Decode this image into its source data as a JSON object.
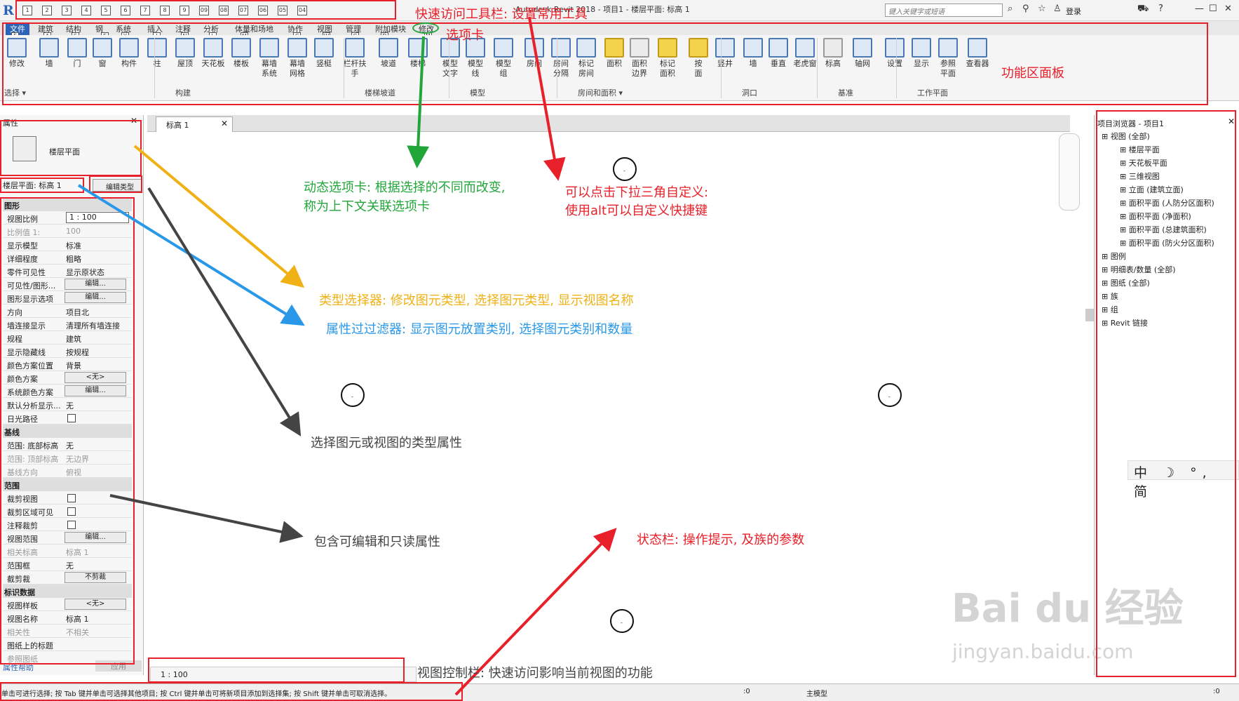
{
  "titlebar": {
    "logo": "R",
    "qa_icons": [
      "1",
      "2",
      "3",
      "4",
      "5",
      "6",
      "7",
      "8",
      "9",
      "09",
      "08",
      "07",
      "06",
      "05",
      "04"
    ],
    "title": "Autodesk Revit 2018 - 项目1 - 楼层平面: 标高 1",
    "search_placeholder": "键入关键字或短语",
    "login_label": "登录",
    "icons": [
      "binoculars-icon",
      "share-icon",
      "star-icon",
      "user-icon",
      "cart-icon",
      "help-icon"
    ],
    "window_controls": [
      "—",
      "☐",
      "✕"
    ]
  },
  "tabs": [
    {
      "label": "文件",
      "key": "F",
      "active": true
    },
    {
      "label": "建筑",
      "key": "A"
    },
    {
      "label": "结构",
      "key": "S"
    },
    {
      "label": "钢",
      "key": "E"
    },
    {
      "label": "系统",
      "key": "Y"
    },
    {
      "label": "插入",
      "key": "I"
    },
    {
      "label": "注释",
      "key": "N"
    },
    {
      "label": "分析",
      "key": "L"
    },
    {
      "label": "体量和场地",
      "key": "M"
    },
    {
      "label": "协作",
      "key": "C"
    },
    {
      "label": "视图",
      "key": "W"
    },
    {
      "label": "管理",
      "key": "G"
    },
    {
      "label": "附加模块",
      "key": "D"
    },
    {
      "label": "修改",
      "key": "M"
    }
  ],
  "ribbon": {
    "buttons": [
      {
        "label": "修改"
      },
      {
        "label": "墙"
      },
      {
        "label": "门"
      },
      {
        "label": "窗"
      },
      {
        "label": "构件"
      },
      {
        "label": "柱"
      },
      {
        "label": "屋顶"
      },
      {
        "label": "天花板"
      },
      {
        "label": "楼板"
      },
      {
        "label": "幕墙\n系统"
      },
      {
        "label": "幕墙\n网格"
      },
      {
        "label": "竖梃"
      },
      {
        "label": "栏杆扶手"
      },
      {
        "label": "坡道"
      },
      {
        "label": "楼梯"
      },
      {
        "label": "模型\n文字"
      },
      {
        "label": "模型\n线"
      },
      {
        "label": "模型\n组"
      },
      {
        "label": "房间"
      },
      {
        "label": "房间\n分隔"
      },
      {
        "label": "标记\n房间"
      },
      {
        "label": "面积"
      },
      {
        "label": "面积\n边界"
      },
      {
        "label": "标记\n面积"
      },
      {
        "label": "按\n面"
      },
      {
        "label": "竖井"
      },
      {
        "label": "墙"
      },
      {
        "label": "垂直"
      },
      {
        "label": "老虎窗"
      },
      {
        "label": "标高"
      },
      {
        "label": "轴网"
      },
      {
        "label": "设置"
      },
      {
        "label": "显示"
      },
      {
        "label": "参照\n平面"
      },
      {
        "label": "查看器"
      }
    ],
    "panels": [
      "选择 ▾",
      "构建",
      "楼梯坡道",
      "模型",
      "房间和面积 ▾",
      "洞口",
      "基准",
      "工作平面"
    ]
  },
  "doc_tab": {
    "label": "标高 1"
  },
  "properties": {
    "header": "属性",
    "type_name": "楼层平面",
    "filter": "楼层平面: 标高 1",
    "edit_type": "编辑类型",
    "groups": [
      {
        "name": "图形",
        "rows": [
          [
            "视图比例",
            "1 : 100",
            "input"
          ],
          [
            "比例值 1:",
            "100",
            "dim"
          ],
          [
            "显示模型",
            "标准",
            ""
          ],
          [
            "详细程度",
            "粗略",
            ""
          ],
          [
            "零件可见性",
            "显示原状态",
            ""
          ],
          [
            "可见性/图形...",
            "编辑...",
            "btn"
          ],
          [
            "图形显示选项",
            "编辑...",
            "btn"
          ],
          [
            "方向",
            "项目北",
            ""
          ],
          [
            "墙连接显示",
            "清理所有墙连接",
            ""
          ],
          [
            "规程",
            "建筑",
            ""
          ],
          [
            "显示隐藏线",
            "按规程",
            ""
          ],
          [
            "颜色方案位置",
            "背景",
            ""
          ],
          [
            "颜色方案",
            "<无>",
            "btn"
          ],
          [
            "系统颜色方案",
            "编辑...",
            "btn"
          ],
          [
            "默认分析显示...",
            "无",
            ""
          ],
          [
            "日光路径",
            "",
            "chk"
          ]
        ]
      },
      {
        "name": "基线",
        "rows": [
          [
            "范围: 底部标高",
            "无",
            ""
          ],
          [
            "范围: 顶部标高",
            "无边界",
            "dim"
          ],
          [
            "基线方向",
            "俯视",
            "dim"
          ]
        ]
      },
      {
        "name": "范围",
        "rows": [
          [
            "裁剪视图",
            "",
            "chk"
          ],
          [
            "裁剪区域可见",
            "",
            "chk"
          ],
          [
            "注释裁剪",
            "",
            "chk"
          ],
          [
            "视图范围",
            "编辑...",
            "btn"
          ],
          [
            "相关标高",
            "标高 1",
            "dim"
          ],
          [
            "范围框",
            "无",
            ""
          ],
          [
            "截剪裁",
            "不剪裁",
            "btn"
          ]
        ]
      },
      {
        "name": "标识数据",
        "rows": [
          [
            "视图样板",
            "<无>",
            "btn"
          ],
          [
            "视图名称",
            "标高 1",
            ""
          ],
          [
            "相关性",
            "不相关",
            "dim"
          ],
          [
            "图纸上的标题",
            "",
            ""
          ],
          [
            "参照图纸",
            "",
            "dim"
          ]
        ]
      }
    ],
    "help": "属性帮助",
    "apply": "应用"
  },
  "browser": {
    "header": "项目浏览器 - 项目1",
    "items": [
      {
        "label": "视图 (全部)",
        "level": 0
      },
      {
        "label": "楼层平面",
        "level": 1
      },
      {
        "label": "天花板平面",
        "level": 1
      },
      {
        "label": "三维视图",
        "level": 1
      },
      {
        "label": "立面 (建筑立面)",
        "level": 1
      },
      {
        "label": "面积平面 (人防分区面积)",
        "level": 1
      },
      {
        "label": "面积平面 (净面积)",
        "level": 1
      },
      {
        "label": "面积平面 (总建筑面积)",
        "level": 1
      },
      {
        "label": "面积平面 (防火分区面积)",
        "level": 1
      },
      {
        "label": "图例",
        "level": 0
      },
      {
        "label": "明细表/数量 (全部)",
        "level": 0
      },
      {
        "label": "图纸 (全部)",
        "level": 0
      },
      {
        "label": "族",
        "level": 0
      },
      {
        "label": "组",
        "level": 0
      },
      {
        "label": "Revit 链接",
        "level": 0
      }
    ]
  },
  "view_control": {
    "scale": "1 : 100"
  },
  "status": {
    "hint": "单击可进行选择; 按 Tab 键并单击可选择其他项目; 按 Ctrl 键并单击可将新项目添加到选择集; 按 Shift 键并单击可取消选择。",
    "model": "主模型",
    "count1": ":0",
    "count2": ":0"
  },
  "annotations": {
    "qat": "快速访问工具栏: 设置常用工具",
    "tabs": "选项卡",
    "ribbon": "功能区面板",
    "context1": "动态选项卡: 根据选择的不同而改变,",
    "context2": "称为上下文关联选项卡",
    "custom1": "可以点击下拉三角自定义:",
    "custom2": "使用alt可以自定义快捷键",
    "type_sel": "类型选择器: 修改图元类型, 选择图元类型, 显示视图名称",
    "prop_filter": "属性过过滤器: 显示图元放置类别, 选择图元类别和数量",
    "type_prop": "选择图元或视图的类型属性",
    "editable": "包含可编辑和只读属性",
    "statusbar": "状态栏: 操作提示, 及族的参数",
    "viewctrl": "视图控制栏: 快速访问影响当前视图的功能"
  },
  "ime": "中 ☽ °, 简",
  "watermark": {
    "logo": "Bai du 经验",
    "url": "jingyan.baidu.com"
  },
  "colors": {
    "tab_active": "#2d64b8",
    "annotation_red": "#e8202a",
    "annotation_green": "#22a63a",
    "annotation_yellow": "#f0b114",
    "annotation_blue": "#2a98e8"
  }
}
